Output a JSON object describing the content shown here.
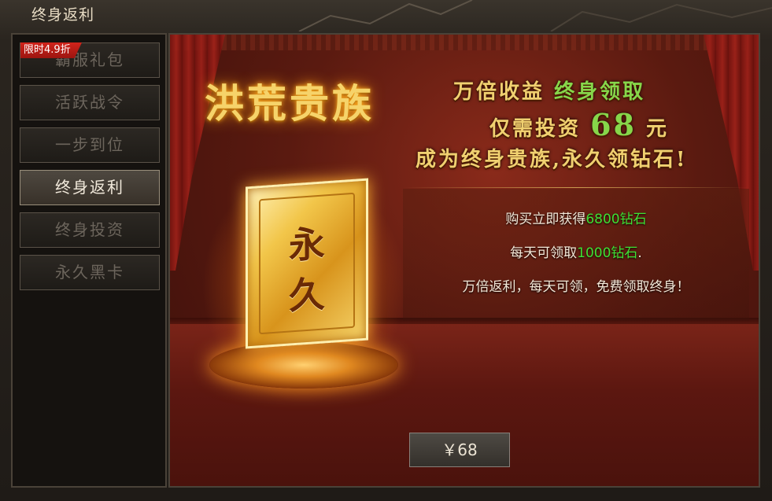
{
  "window": {
    "title": "终身返利"
  },
  "sidebar": {
    "sale_ribbon": "限时4.9折",
    "items": [
      {
        "label": "霸服礼包"
      },
      {
        "label": "活跃战令"
      },
      {
        "label": "一步到位"
      },
      {
        "label": "终身返利"
      },
      {
        "label": "终身投资"
      },
      {
        "label": "永久黑卡"
      }
    ],
    "active_index": 3
  },
  "banner": {
    "headline": "洪荒贵族",
    "slogan_line1_a": "万倍收益",
    "slogan_line1_b": "终身领取",
    "slogan_line2_a": "仅需投资",
    "slogan_line2_amount": "68",
    "slogan_line2_b": "元",
    "slogan_line3": "成为终身贵族,永久领钻石!",
    "card_char_1": "永",
    "card_char_2": "久"
  },
  "info": {
    "line1_a": "购买立即获得",
    "line1_value": "6800钻石",
    "line2_a": "每天可领取",
    "line2_value": "1000钻石",
    "line2_b": ".",
    "line3": "万倍返利，每天可领，免费领取终身！"
  },
  "buy": {
    "label": "￥68"
  },
  "colors": {
    "highlight_green": "#3fe034",
    "gold": "#f6d36a",
    "active_tab_text": "#f2eadc"
  }
}
